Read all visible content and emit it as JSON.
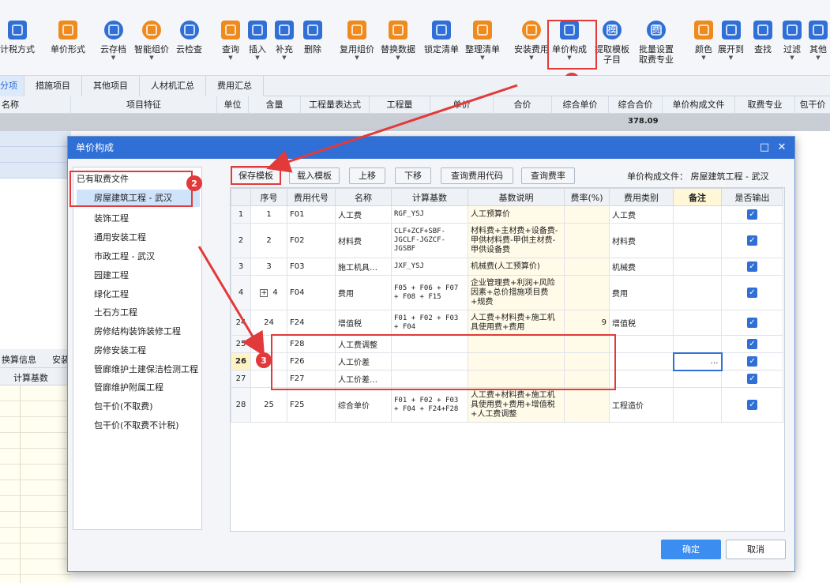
{
  "toolbar": {
    "tax_method": "计税方式",
    "unit_price_form": "单价形式",
    "cloud_save": "云存档",
    "smart_pricing": "智能组价",
    "cloud_check": "云检查",
    "query": "查询",
    "insert": "插入",
    "supplement": "补充",
    "delete": "删除",
    "reuse_pricing": "复用组价",
    "replace_data": "替换数据",
    "lock_list": "锁定清单",
    "organize_list": "整理清单",
    "install_fee": "安装费用",
    "unit_price_composition": "单价构成",
    "extract_template_line1": "提取模板",
    "extract_template_line2": "子目",
    "batch_setup_line1": "批量设置",
    "batch_setup_line2": "取费专业",
    "color": "颜色",
    "expand_to": "展开到",
    "find": "查找",
    "filter": "过滤",
    "other": "其他"
  },
  "icons": {
    "template": "模",
    "fee": "费"
  },
  "tabs": [
    "分项",
    "措施项目",
    "其他项目",
    "人材机汇总",
    "费用汇总"
  ],
  "main_grid": {
    "headers": [
      "名称",
      "项目特征",
      "单位",
      "含量",
      "工程量表达式",
      "工程量",
      "单价",
      "合价",
      "综合单价",
      "综合合价",
      "单价构成文件",
      "取费专业",
      "包干价"
    ],
    "sum_value": "378.09"
  },
  "lower_panel": {
    "tabs": [
      "换算信息",
      "安装"
    ],
    "header": "计算基数"
  },
  "dialog": {
    "title": "单价构成",
    "file_root": "已有取费文件",
    "files": [
      "房屋建筑工程 - 武汉",
      "装饰工程",
      "通用安装工程",
      "市政工程 - 武汉",
      "园建工程",
      "绿化工程",
      "土石方工程",
      "房修结构装饰装修工程",
      "房修安装工程",
      "管廊维护土建保洁检测工程",
      "管廊维护附属工程",
      "包干价(不取费)",
      "包干价(不取费不计税)"
    ],
    "buttons": [
      "保存模板",
      "载入模板",
      "上移",
      "下移",
      "查询费用代码",
      "查询费率"
    ],
    "file_label": "单价构成文件：  房屋建筑工程 - 武汉",
    "columns": [
      "序号",
      "费用代号",
      "名称",
      "计算基数",
      "基数说明",
      "费率(%)",
      "费用类别",
      "备注",
      "是否输出"
    ],
    "rows": [
      {
        "idx": "1",
        "seq": "1",
        "code": "F01",
        "name": "人工费",
        "base": "RGF_YSJ",
        "desc": "人工预算价",
        "rate": "",
        "cat": "人工费"
      },
      {
        "idx": "2",
        "seq": "2",
        "code": "F02",
        "name": "材料费",
        "base": "CLF+ZCF+SBF-JGCLF-JGZCF-JGSBF",
        "desc": "材料费+主材费+设备费-甲供材料费-甲供主材费-甲供设备费",
        "rate": "",
        "cat": "材料费"
      },
      {
        "idx": "3",
        "seq": "3",
        "code": "F03",
        "name": "施工机具…",
        "base": "JXF_YSJ",
        "desc": "机械费(人工预算价)",
        "rate": "",
        "cat": "机械费"
      },
      {
        "idx": "4",
        "seq": "4",
        "code": "F04",
        "name": "费用",
        "base": "F05 + F06 + F07 + F08 + F15",
        "desc": "企业管理费+利润+风险因素+总价措施项目费+规费",
        "rate": "",
        "cat": "费用"
      },
      {
        "idx": "24",
        "seq": "24",
        "code": "F24",
        "name": "增值税",
        "base": "F01 + F02 + F03 + F04",
        "desc": "人工费+材料费+施工机具使用费+费用",
        "rate": "9",
        "cat": "增值税"
      },
      {
        "idx": "25",
        "seq": "",
        "code": "F28",
        "name": "人工费调整",
        "base": "",
        "desc": "",
        "rate": "",
        "cat": ""
      },
      {
        "idx": "26",
        "seq": "",
        "code": "F26",
        "name": "人工价差",
        "base": "",
        "desc": "",
        "rate": "",
        "cat": ""
      },
      {
        "idx": "27",
        "seq": "",
        "code": "F27",
        "name": "人工价差…",
        "base": "",
        "desc": "",
        "rate": "",
        "cat": ""
      },
      {
        "idx": "28",
        "seq": "25",
        "code": "F25",
        "name": "综合单价",
        "base": "F01 + F02 + F03 + F04 + F24+F28",
        "desc": "人工费+材料费+施工机具使用费+费用+增值税+人工费调整",
        "rate": "",
        "cat": "工程造价"
      }
    ],
    "ellipsis": "…",
    "check_mark": "✓",
    "plus_mark": "+",
    "ok": "确定",
    "cancel": "取消"
  },
  "annotations": [
    "1",
    "2",
    "3"
  ],
  "colors": {
    "accent": "#2f6fd6",
    "highlight": "#e23a3a"
  }
}
